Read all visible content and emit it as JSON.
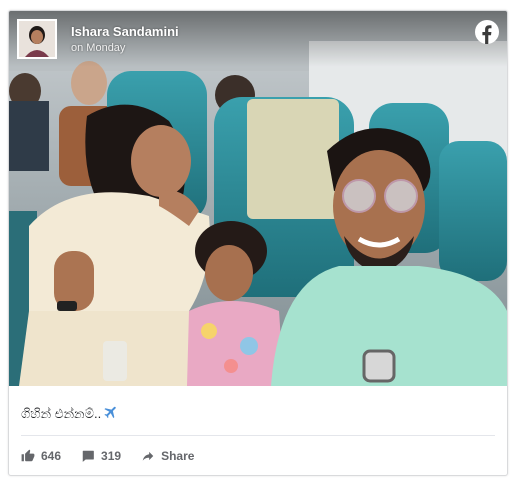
{
  "post": {
    "author": "Ishara Sandamini",
    "time": "on Monday",
    "caption": "ගිහින් එන්නම්..",
    "caption_icon": "airplane-icon",
    "platform_icon": "facebook-icon"
  },
  "actions": {
    "likes": "646",
    "comments": "319",
    "share_label": "Share"
  },
  "colors": {
    "facebook": "#ffffff",
    "action_text": "#65676b",
    "caption_text": "#1c1e21",
    "plane": "#4a90d9",
    "seat_teal": "#2e8f9e"
  }
}
